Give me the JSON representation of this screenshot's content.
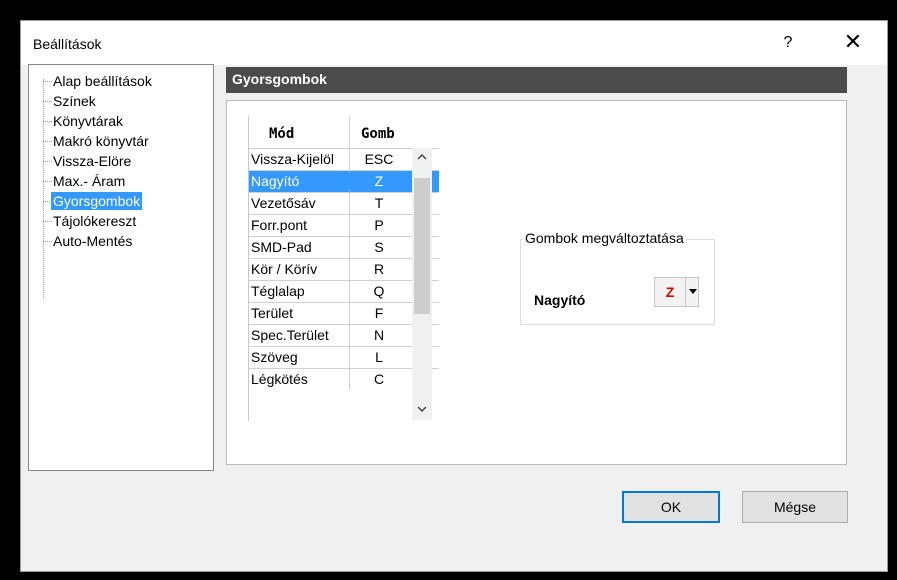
{
  "window": {
    "title": "Beállítások",
    "help_label": "?",
    "close_label": "✕"
  },
  "tree": {
    "items": [
      {
        "label": "Alap beállítások",
        "selected": false
      },
      {
        "label": "Színek",
        "selected": false
      },
      {
        "label": "Könyvtárak",
        "selected": false
      },
      {
        "label": "Makró könyvtár",
        "selected": false
      },
      {
        "label": "Vissza-Elöre",
        "selected": false
      },
      {
        "label": "Max.- Áram",
        "selected": false
      },
      {
        "label": "Gyorsgombok",
        "selected": true
      },
      {
        "label": "Tájolókereszt",
        "selected": false
      },
      {
        "label": "Auto-Mentés",
        "selected": false
      }
    ]
  },
  "section": {
    "title": "Gyorsgombok"
  },
  "grid": {
    "columns": [
      "Mód",
      "Gomb"
    ],
    "rows": [
      {
        "mod": "Vissza-Kijelöl",
        "gomb": "ESC",
        "selected": false
      },
      {
        "mod": "Nagyító",
        "gomb": "Z",
        "selected": true
      },
      {
        "mod": "Vezetősáv",
        "gomb": "T",
        "selected": false
      },
      {
        "mod": "Forr.pont",
        "gomb": "P",
        "selected": false
      },
      {
        "mod": "SMD-Pad",
        "gomb": "S",
        "selected": false
      },
      {
        "mod": "Kör / Körív",
        "gomb": "R",
        "selected": false
      },
      {
        "mod": "Téglalap",
        "gomb": "Q",
        "selected": false
      },
      {
        "mod": "Terület",
        "gomb": "F",
        "selected": false
      },
      {
        "mod": "Spec.Terület",
        "gomb": "N",
        "selected": false
      },
      {
        "mod": "Szöveg",
        "gomb": "L",
        "selected": false
      },
      {
        "mod": "Légkötés",
        "gomb": "C",
        "selected": false
      }
    ],
    "scroll_up_icon": "chevron-up-icon",
    "scroll_down_icon": "chevron-down-icon"
  },
  "change_group": {
    "title": "Gombok megváltoztatása",
    "label": "Nagyító",
    "value": "Z",
    "value_color": "#e00000"
  },
  "buttons": {
    "ok": "OK",
    "cancel": "Mégse"
  },
  "colors": {
    "selection": "#3399ff",
    "header_bg": "#4b4b4b",
    "ok_border": "#0078d7"
  }
}
